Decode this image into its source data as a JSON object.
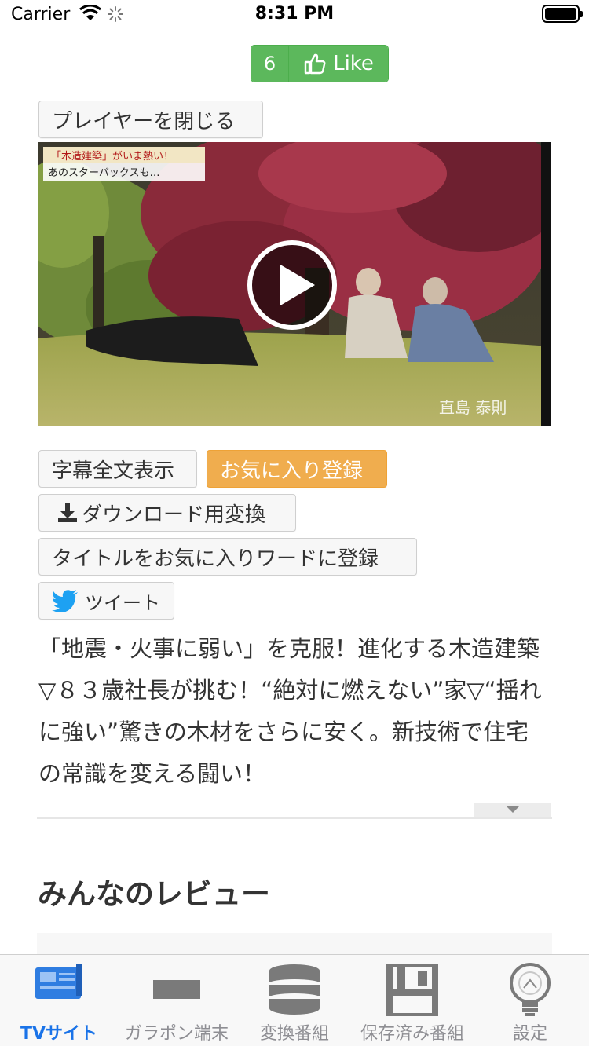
{
  "status_bar": {
    "carrier": "Carrier",
    "time": "8:31 PM"
  },
  "like": {
    "count": "6",
    "label": "Like"
  },
  "player": {
    "close_label": "プレイヤーを閉じる",
    "overlay_caption_1": "「木造建築」がいま熱い！",
    "overlay_caption_2": "あのスターバックスも…",
    "overlay_name": "直島 泰則"
  },
  "actions": {
    "subtitles_label": "字幕全文表示",
    "favorite_label": "お気に入り登録",
    "download_label": "ダウンロード用変換",
    "title_fav_word_label": "タイトルをお気に入りワードに登録",
    "tweet_label": "ツイート"
  },
  "description": "「地震・火事に弱い」を克服！進化する木造建築▽８３歳社長が挑む！“絶対に燃えない”家▽“揺れに強い”驚きの木材をさらに安く。新技術で住宅の常識を変える闘い！",
  "reviews": {
    "title": "みんなのレビュー"
  },
  "tabs": [
    {
      "label": "TVサイト",
      "icon": "tv-site-icon",
      "active": true
    },
    {
      "label": "ガラポン端末",
      "icon": "device-icon",
      "active": false
    },
    {
      "label": "変換番組",
      "icon": "database-icon",
      "active": false
    },
    {
      "label": "保存済み番組",
      "icon": "floppy-disk-icon",
      "active": false
    },
    {
      "label": "設定",
      "icon": "lightbulb-icon",
      "active": false
    }
  ],
  "colors": {
    "like_green": "#5cb85c",
    "favorite_orange": "#f0ad4e",
    "tab_active": "#1a73e8",
    "tab_inactive": "#8e8e93"
  }
}
